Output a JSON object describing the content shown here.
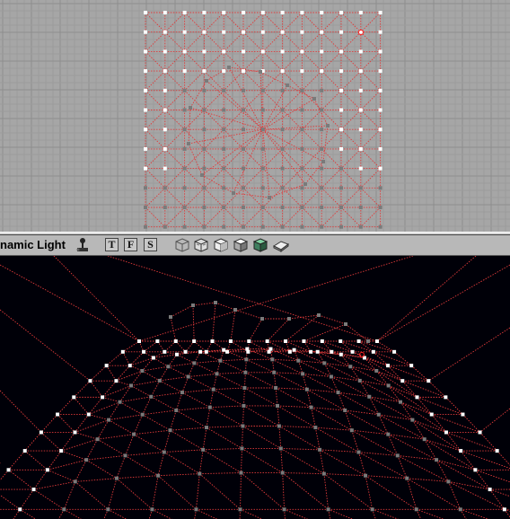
{
  "toolbar": {
    "mode_label": "namic Light",
    "view_buttons": [
      {
        "label": "T",
        "icon": "top-view"
      },
      {
        "label": "F",
        "icon": "front-view"
      },
      {
        "label": "S",
        "icon": "side-view"
      }
    ],
    "render_icons": [
      "wireframe-cube-icon",
      "zone-cube-icon",
      "textured-cube-icon",
      "shaded-cube-icon",
      "lit-cube-icon",
      "book-icon"
    ]
  },
  "colors": {
    "grid_bg": "#a6a6a6",
    "wire": "#e03a3a",
    "vertex_selected": "#ffffff",
    "vertex_unselected": "#7a7a7a",
    "persp_bg": "#000008"
  },
  "top_viewport": {
    "cols": 13,
    "rows": 12
  },
  "persp_viewport": {
    "rows": 12,
    "cols": 14
  }
}
